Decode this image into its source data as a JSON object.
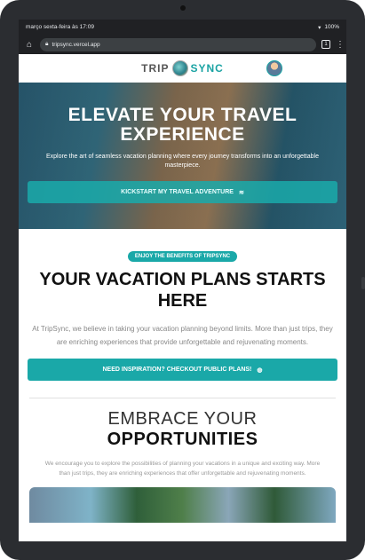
{
  "status_bar": {
    "datetime": "março sexta-feira às 17:09",
    "battery": "100%"
  },
  "browser": {
    "url": "tripsync.vercel.app",
    "tab_count": "1"
  },
  "header": {
    "logo_left": "TRIP",
    "logo_right": "SYNC"
  },
  "hero": {
    "title": "ELEVATE YOUR TRAVEL EXPERIENCE",
    "subtitle": "Explore the art of seamless vacation planning where every journey transforms into an unforgettable masterpiece.",
    "cta_label": "KICKSTART MY TRAVEL ADVENTURE"
  },
  "benefits": {
    "pill": "ENJOY THE BENEFITS OF TRIPSYNC",
    "title": "YOUR VACATION PLANS STARTS HERE",
    "body": "At TripSync, we believe in taking your vacation planning beyond limits. More than just trips, they are enriching experiences that provide unforgettable and rejuvenating moments.",
    "button_label": "NEED INSPIRATION? CHECKOUT PUBLIC PLANS!"
  },
  "embrace": {
    "title_light": "EMBRACE YOUR",
    "title_bold": "OPPORTUNITIES",
    "body": "We encourage you to explore the possibilities of planning your vacations in a unique and exciting way. More than just trips, they are enriching experiences that offer unforgettable and rejuvenating moments."
  },
  "colors": {
    "accent": "#1aa8a8"
  }
}
